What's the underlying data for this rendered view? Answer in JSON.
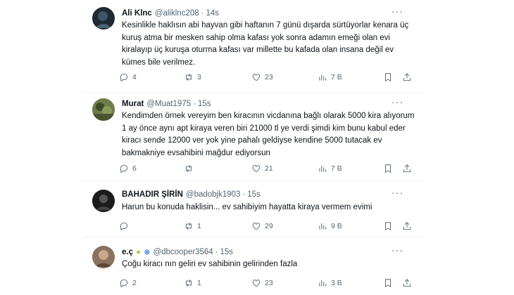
{
  "tweets": [
    {
      "name": "Ali Klnc",
      "handle": "@aliklnc208",
      "sep": "·",
      "time": "14s",
      "text": "Kesinlikle haklısın abi hayvan gibi haftanın 7 günü dışarda sürtüyorlar kenara üç kuruş atma bir mesken sahip olma kafası yok sonra adamın emeği olan evi kiralayıp üç kuruşa oturma kafası var millette bu kafada olan insana değil ev kümes bile verilmez.",
      "replies": "4",
      "reposts": "3",
      "likes": "23",
      "views": "7 B",
      "avatar_color": "#2b3a45"
    },
    {
      "name": "Murat",
      "handle": "@Muat1975",
      "sep": "·",
      "time": "15s",
      "text": "Kendimden örnek vereyim ben kiracının vicdanına bağlı olarak 5000 kira alıyorum 1 ay önce aynı apt kiraya veren biri 21000 tl ye verdi şimdi kim bunu kabul eder kiracı sende 12000 ver yok yine pahalı geldiyse kendine 5000 tutacak ev bakmakniye evsahibini mağdur ediyorsun",
      "replies": "6",
      "reposts": "",
      "likes": "21",
      "views": "7 B",
      "avatar_color": "#5a6b3a"
    },
    {
      "name": "BAHADIR ŞİRİN",
      "handle": "@badobjk1903",
      "sep": "·",
      "time": "15s",
      "text": "Harun bu konuda haklisin... ev sahibiyim hayatta kiraya vermem evimi",
      "replies": "",
      "reposts": "1",
      "likes": "29",
      "views": "9 B",
      "avatar_color": "#2a2a2a"
    },
    {
      "name": "e.ç",
      "handle": "@dbcooper3564",
      "sep": "·",
      "time": "15s",
      "text": "Çoğu kiracı nın geliri ev sahibinin gelirinden fazla",
      "replies": "2",
      "reposts": "1",
      "likes": "23",
      "views": "3 B",
      "avatar_color": "#7a6450"
    }
  ],
  "icons": {
    "more": "more-dots-icon",
    "reply": "reply-icon",
    "repost": "repost-icon",
    "like": "heart-icon",
    "views": "views-icon",
    "bookmark": "bookmark-icon",
    "share": "share-icon",
    "emoji1": "sparkle-leaf-emoji",
    "emoji2": "butterfly-emoji"
  },
  "colors": {
    "text": "#0f1419",
    "muted": "#536471",
    "border": "#eff3f4"
  }
}
